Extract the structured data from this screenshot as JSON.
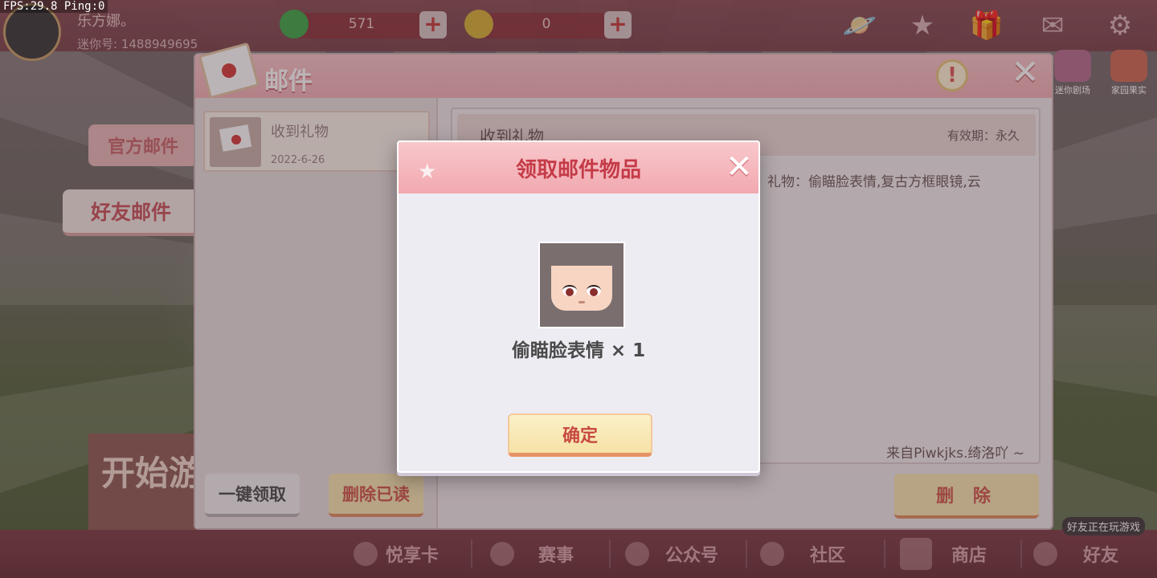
{
  "debug": {
    "fps_text": "FPS:29.8  Ping:0"
  },
  "player": {
    "name": "乐方娜。",
    "id_text": "迷你号: 1488949695"
  },
  "currency": [
    {
      "name": "green-coin",
      "value": "571",
      "color": "#3fa84a"
    },
    {
      "name": "gold-coin",
      "value": "0",
      "color": "#d7b23a"
    }
  ],
  "top_icons": [
    "planet-icon",
    "star-icon",
    "gift-icon",
    "mail-icon",
    "gear-icon"
  ],
  "side_icons": [
    "迷你剧场",
    "家园果实"
  ],
  "tabs": {
    "official": "官方邮件",
    "friend": "好友邮件"
  },
  "mail_window": {
    "title": "邮件",
    "items": [
      {
        "title": "收到礼物",
        "date": "2022-6-26"
      }
    ],
    "detail": {
      "title": "收到礼物",
      "expiry": "有效期：永久",
      "body": "礼物：偷瞄脸表情,复古方框眼镜,云",
      "from": "来自Piwkjks.绮洛吖 ~"
    },
    "claim_all_label": "一键领取",
    "delete_read_label": "删除已读",
    "delete_label": "删 除"
  },
  "start_game_label": "开始游",
  "dialog": {
    "title": "领取邮件物品",
    "item_name": "偷瞄脸表情",
    "item_qty": "× 1",
    "confirm_label": "确定"
  },
  "bottom_nav": [
    {
      "label": "悦享卡",
      "icon": "pig-card-icon"
    },
    {
      "label": "赛事",
      "icon": "trophy-icon"
    },
    {
      "label": "公众号",
      "icon": "star-badge-icon"
    },
    {
      "label": "社区",
      "icon": "community-icon"
    },
    {
      "label": "商店",
      "icon": "cart-icon"
    },
    {
      "label": "好友",
      "icon": "friend-icon"
    }
  ],
  "friend_playing_text": "好友正在玩游戏"
}
